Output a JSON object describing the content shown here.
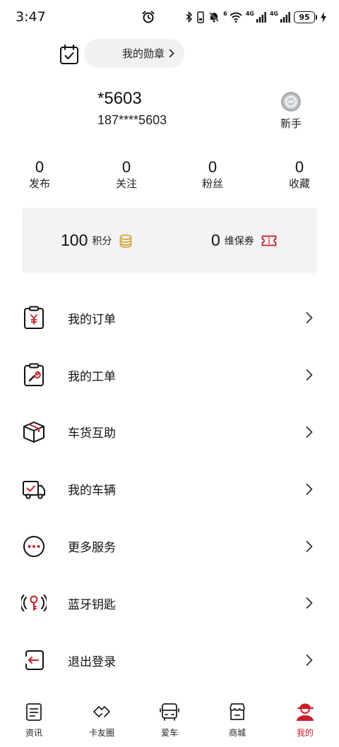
{
  "status_bar": {
    "time": "3:47",
    "battery": "95",
    "network_labels": [
      "6",
      "4G",
      "4G"
    ]
  },
  "medal": {
    "label": "我的勋章",
    "chevron": "›"
  },
  "profile": {
    "name": "*5603",
    "phone": "187****5603",
    "level": "新手"
  },
  "stats": [
    {
      "value": "0",
      "label": "发布"
    },
    {
      "value": "0",
      "label": "关注"
    },
    {
      "value": "0",
      "label": "粉丝"
    },
    {
      "value": "0",
      "label": "收藏"
    }
  ],
  "points": {
    "score_value": "100",
    "score_label": "积分",
    "coupon_value": "0",
    "coupon_label": "维保券"
  },
  "menu": [
    {
      "label": "我的订单",
      "icon": "order-clipboard-icon"
    },
    {
      "label": "我的工单",
      "icon": "work-order-wrench-icon"
    },
    {
      "label": "车货互助",
      "icon": "cargo-box-icon"
    },
    {
      "label": "我的车辆",
      "icon": "truck-icon"
    },
    {
      "label": "更多服务",
      "icon": "more-dots-icon"
    },
    {
      "label": "蓝牙钥匙",
      "icon": "bluetooth-key-icon"
    },
    {
      "label": "退出登录",
      "icon": "logout-icon"
    }
  ],
  "nav": [
    {
      "label": "资讯",
      "icon": "news-icon"
    },
    {
      "label": "卡友圈",
      "icon": "community-icon"
    },
    {
      "label": "爱车",
      "icon": "car-icon"
    },
    {
      "label": "商城",
      "icon": "store-icon"
    },
    {
      "label": "我的",
      "icon": "profile-icon",
      "active": true
    }
  ],
  "colors": {
    "accent": "#c81e28",
    "gold": "#d8a53a",
    "card_bg": "#f2f3f5"
  }
}
